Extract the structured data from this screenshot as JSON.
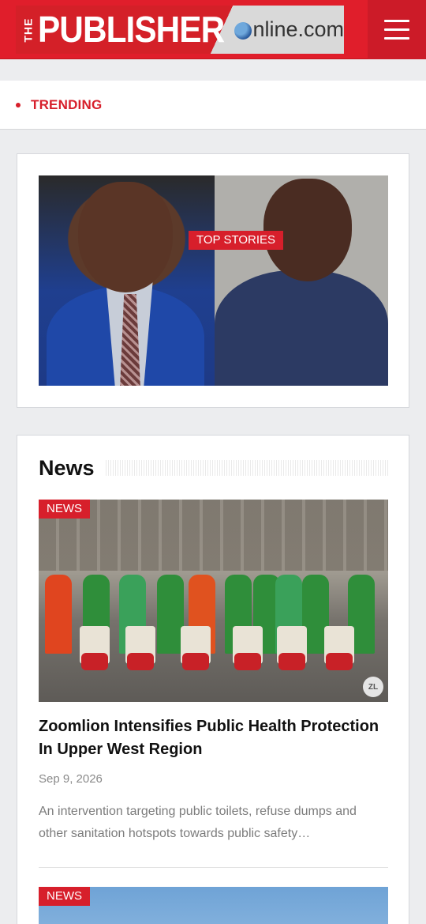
{
  "header": {
    "logo_the": "THE",
    "logo_main": "PUBLISHER",
    "logo_online": "nline.com",
    "menu_icon": "hamburger-menu-icon",
    "brand_color": "#e01e2b"
  },
  "trending": {
    "label": "TRENDING"
  },
  "top_stories": {
    "tag": "TOP STORIES"
  },
  "news_section": {
    "heading": "News",
    "articles": [
      {
        "tag": "NEWS",
        "title": "Zoomlion Intensifies Public Health Protection In Upper West Region",
        "date": "Sep 9, 2026",
        "excerpt": "An intervention targeting public toilets, refuse dumps and other sanitation hotspots towards public safety…",
        "watermark": "ZL"
      },
      {
        "tag": "NEWS"
      }
    ]
  },
  "colors": {
    "accent_red": "#d71f2b",
    "page_bg": "#ecedef"
  }
}
